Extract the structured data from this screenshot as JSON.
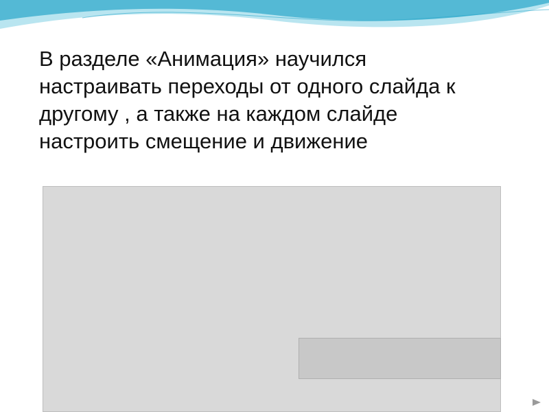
{
  "slide": {
    "text_lines": [
      "В разделе «Анимация» научился",
      "настраивать переходы от одного слайда к",
      "другому , а также на каждом слайде",
      "настроить смещение и движение"
    ]
  },
  "colors": {
    "wave_primary": "#2aa7c9",
    "wave_secondary": "#7fd0e4",
    "text": "#111111"
  },
  "icons": {
    "nav_arrow": "play-arrow-icon"
  }
}
